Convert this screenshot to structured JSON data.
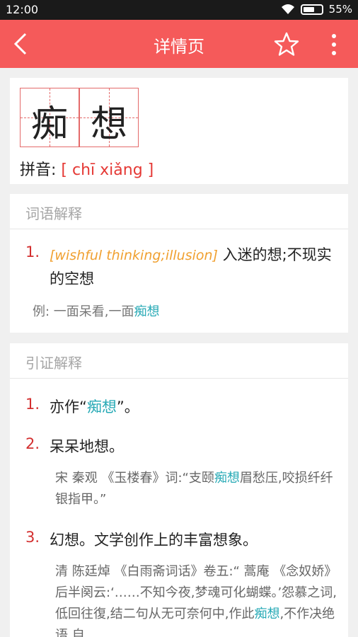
{
  "status_bar": {
    "time": "12:00",
    "battery": "55%",
    "battery_level": 0.55
  },
  "toolbar": {
    "back_icon": "chevron-left-icon",
    "title": "详情页",
    "favorite_icon": "star-outline-icon",
    "more_icon": "more-vertical-icon"
  },
  "word": {
    "chars": [
      "痴",
      "想"
    ],
    "pinyin_label": "拼音:",
    "pinyin_value": "[ chī xiǎng ]"
  },
  "meaning_section": {
    "title": "词语解释",
    "items": [
      {
        "num": "1.",
        "english": "[wishful thinking;illusion]",
        "text": " 入迷的想;不现实的空想",
        "example_prefix": "例: 一面呆看,一面",
        "example_highlight": "痴想"
      }
    ]
  },
  "citation_section": {
    "title": "引证解释",
    "items": [
      {
        "num": "1.",
        "pre": "亦作“",
        "hl": "痴想",
        "post": "”。"
      },
      {
        "num": "2.",
        "text": "呆呆地想。",
        "quote_pre": "宋 秦观 《玉楼春》词:“支颐",
        "quote_hl": "痴想",
        "quote_post": "眉愁压,咬损纤纤银指甲。”"
      },
      {
        "num": "3.",
        "text": "幻想。文学创作上的丰富想象。",
        "quote_pre": "清 陈廷焯 《白雨斋词话》卷五:“ 蒿庵 《念奴娇》后半阕云:‘……不知今夜,梦魂可化蝴蝶。’怨慕之词,低回往復,结二句从无可奈何中,作此",
        "quote_hl": "痴想",
        "quote_post": ",不作决绝语,自"
      }
    ]
  }
}
